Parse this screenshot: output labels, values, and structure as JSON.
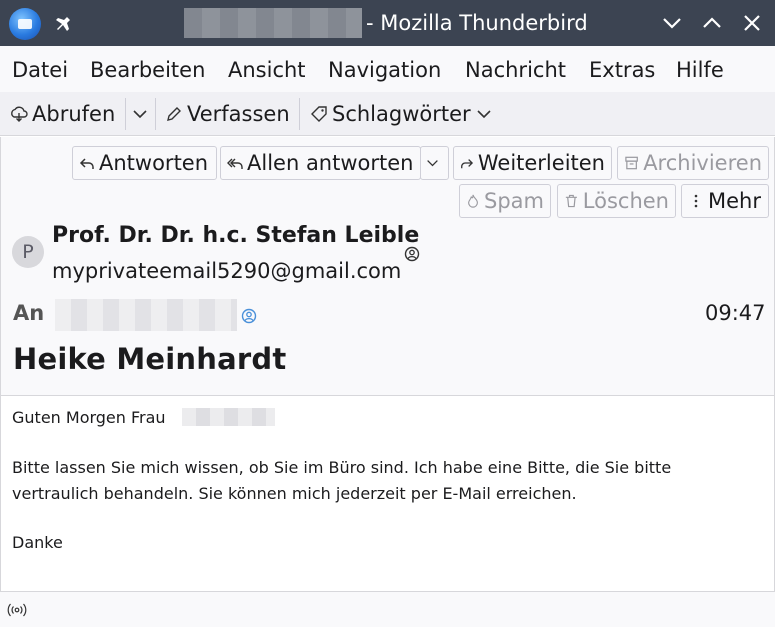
{
  "window": {
    "title": "- Mozilla Thunderbird",
    "icons": [
      "thunderbird-logo-icon",
      "pin-icon",
      "minimize-icon",
      "maximize-icon",
      "close-icon"
    ]
  },
  "menu": {
    "items": [
      {
        "label": "Datei"
      },
      {
        "label": "Bearbeiten"
      },
      {
        "label": "Ansicht"
      },
      {
        "label": "Navigation"
      },
      {
        "label": "Nachricht"
      },
      {
        "label": "Extras"
      },
      {
        "label": "Hilfe"
      }
    ]
  },
  "toolbar": {
    "fetch_label": "Abrufen",
    "compose_label": "Verfassen",
    "tags_label": "Schlagwörter"
  },
  "header_actions": {
    "reply": "Antworten",
    "reply_all": "Allen antworten",
    "forward": "Weiterleiten",
    "archive": "Archivieren",
    "spam": "Spam",
    "delete": "Löschen",
    "more": "Mehr"
  },
  "message": {
    "avatar_letter": "P",
    "sender_name": "Prof. Dr. Dr. h.c. Stefan Leible",
    "sender_email": "myprivateemail5290@gmail.com",
    "to_label": "An",
    "time": "09:47",
    "subject": "Heike Meinhardt",
    "body": {
      "salutation": "Guten Morgen  Frau",
      "line1": "Bitte lassen Sie mich wissen, ob Sie im Büro sind. Ich habe eine Bitte, die Sie bitte",
      "line2": "vertraulich behandeln. Sie können mich jederzeit per E-Mail erreichen.",
      "closing": "Danke"
    }
  },
  "colors": {
    "titlebar": "#3c4452",
    "toolbar": "#f0f0f4",
    "header_bg": "#f9f9fb",
    "text": "#1b1b1d",
    "disabled_text": "#9a9aa0"
  }
}
